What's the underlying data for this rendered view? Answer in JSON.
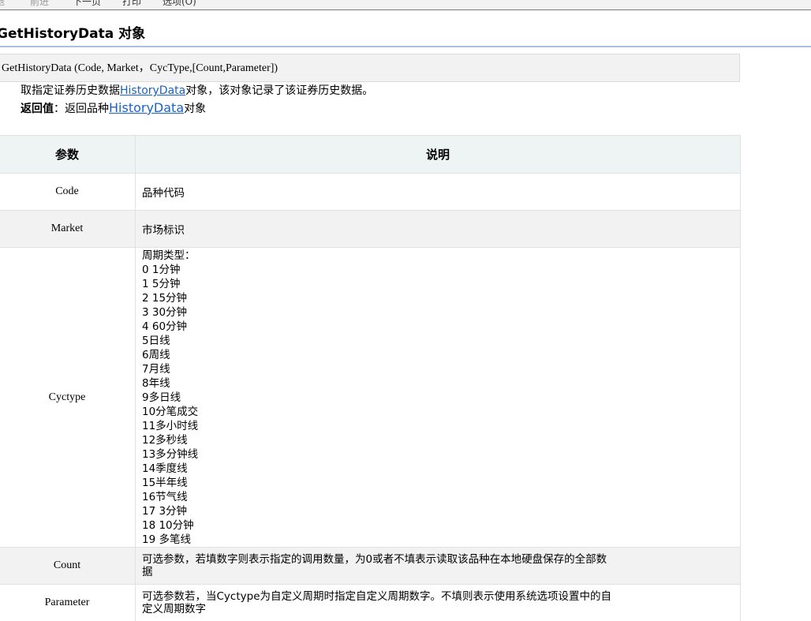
{
  "toolbar": {
    "items": [
      "后退",
      "前进",
      "下一页",
      "打印",
      "选项(O)"
    ]
  },
  "heading": "GetHistoryData 对象",
  "syntax": "GetHistoryData (Code, Market，CycType,[Count,Parameter])",
  "description": {
    "before": "取指定证券历史数据",
    "link": "HistoryData",
    "after": "对象，该对象记录了该证券历史数据。"
  },
  "return_value": {
    "label": "返回值",
    "colon": "：",
    "before": "返回品种",
    "link": "HistoryData",
    "after": "对象"
  },
  "table": {
    "headers": [
      "参数",
      "说明"
    ],
    "rows": {
      "code": {
        "name": "Code",
        "desc": "品种代码"
      },
      "market": {
        "name": "Market",
        "desc": "市场标识"
      },
      "cyctype": {
        "name": "Cyctype",
        "lines": [
          "周期类型：",
          "0 1分钟",
          "1 5分钟",
          "2 15分钟",
          "3 30分钟",
          "4 60分钟",
          "5日线",
          "6周线",
          "7月线",
          "8年线",
          "9多日线",
          "10分笔成交",
          "11多小时线",
          "12多秒线",
          "13多分钟线",
          "14季度线",
          "15半年线",
          "16节气线",
          "17 3分钟",
          "18 10分钟",
          "19 多笔线"
        ]
      },
      "count": {
        "name": "Count",
        "line1": "可选参数，若填数字则表示指定的调用数量，为0或者不填表示读取该品种在本地硬盘保存的全部数",
        "line2": "据"
      },
      "parameter": {
        "name": "Parameter",
        "line1": "可选参数若，当Cyctype为自定义周期时指定自定义周期数字。不填则表示使用系统选项设置中的自",
        "line2": "定义周期数字"
      }
    }
  }
}
